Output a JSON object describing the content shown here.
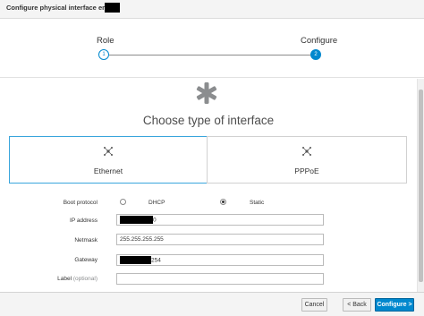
{
  "header": {
    "title": "Configure physical interface ens"
  },
  "wizard": {
    "steps": [
      {
        "label": "Role",
        "number": "1"
      },
      {
        "label": "Configure",
        "number": "2"
      }
    ]
  },
  "main": {
    "icon": "asterisk-icon",
    "title": "Choose type of interface",
    "types": [
      {
        "label": "Ethernet",
        "icon": "network-nodes-icon",
        "selected": true
      },
      {
        "label": "PPPoE",
        "icon": "network-nodes-icon",
        "selected": false
      }
    ]
  },
  "form": {
    "boot_protocol": {
      "label": "Boot protocol",
      "options": [
        {
          "label": "DHCP",
          "checked": false
        },
        {
          "label": "Static",
          "checked": true
        }
      ]
    },
    "ip_address": {
      "label": "IP address",
      "value_suffix": "0"
    },
    "netmask": {
      "label": "Netmask",
      "value": "255.255.255.255"
    },
    "gateway": {
      "label": "Gateway",
      "value_suffix": "254"
    },
    "label_field": {
      "label": "Label",
      "optional": "(optional)",
      "value": ""
    }
  },
  "footer": {
    "cancel": "Cancel",
    "back": "< Back",
    "configure": "Configure >"
  },
  "colors": {
    "accent": "#0088ce",
    "selected_border": "#39a5dc"
  }
}
